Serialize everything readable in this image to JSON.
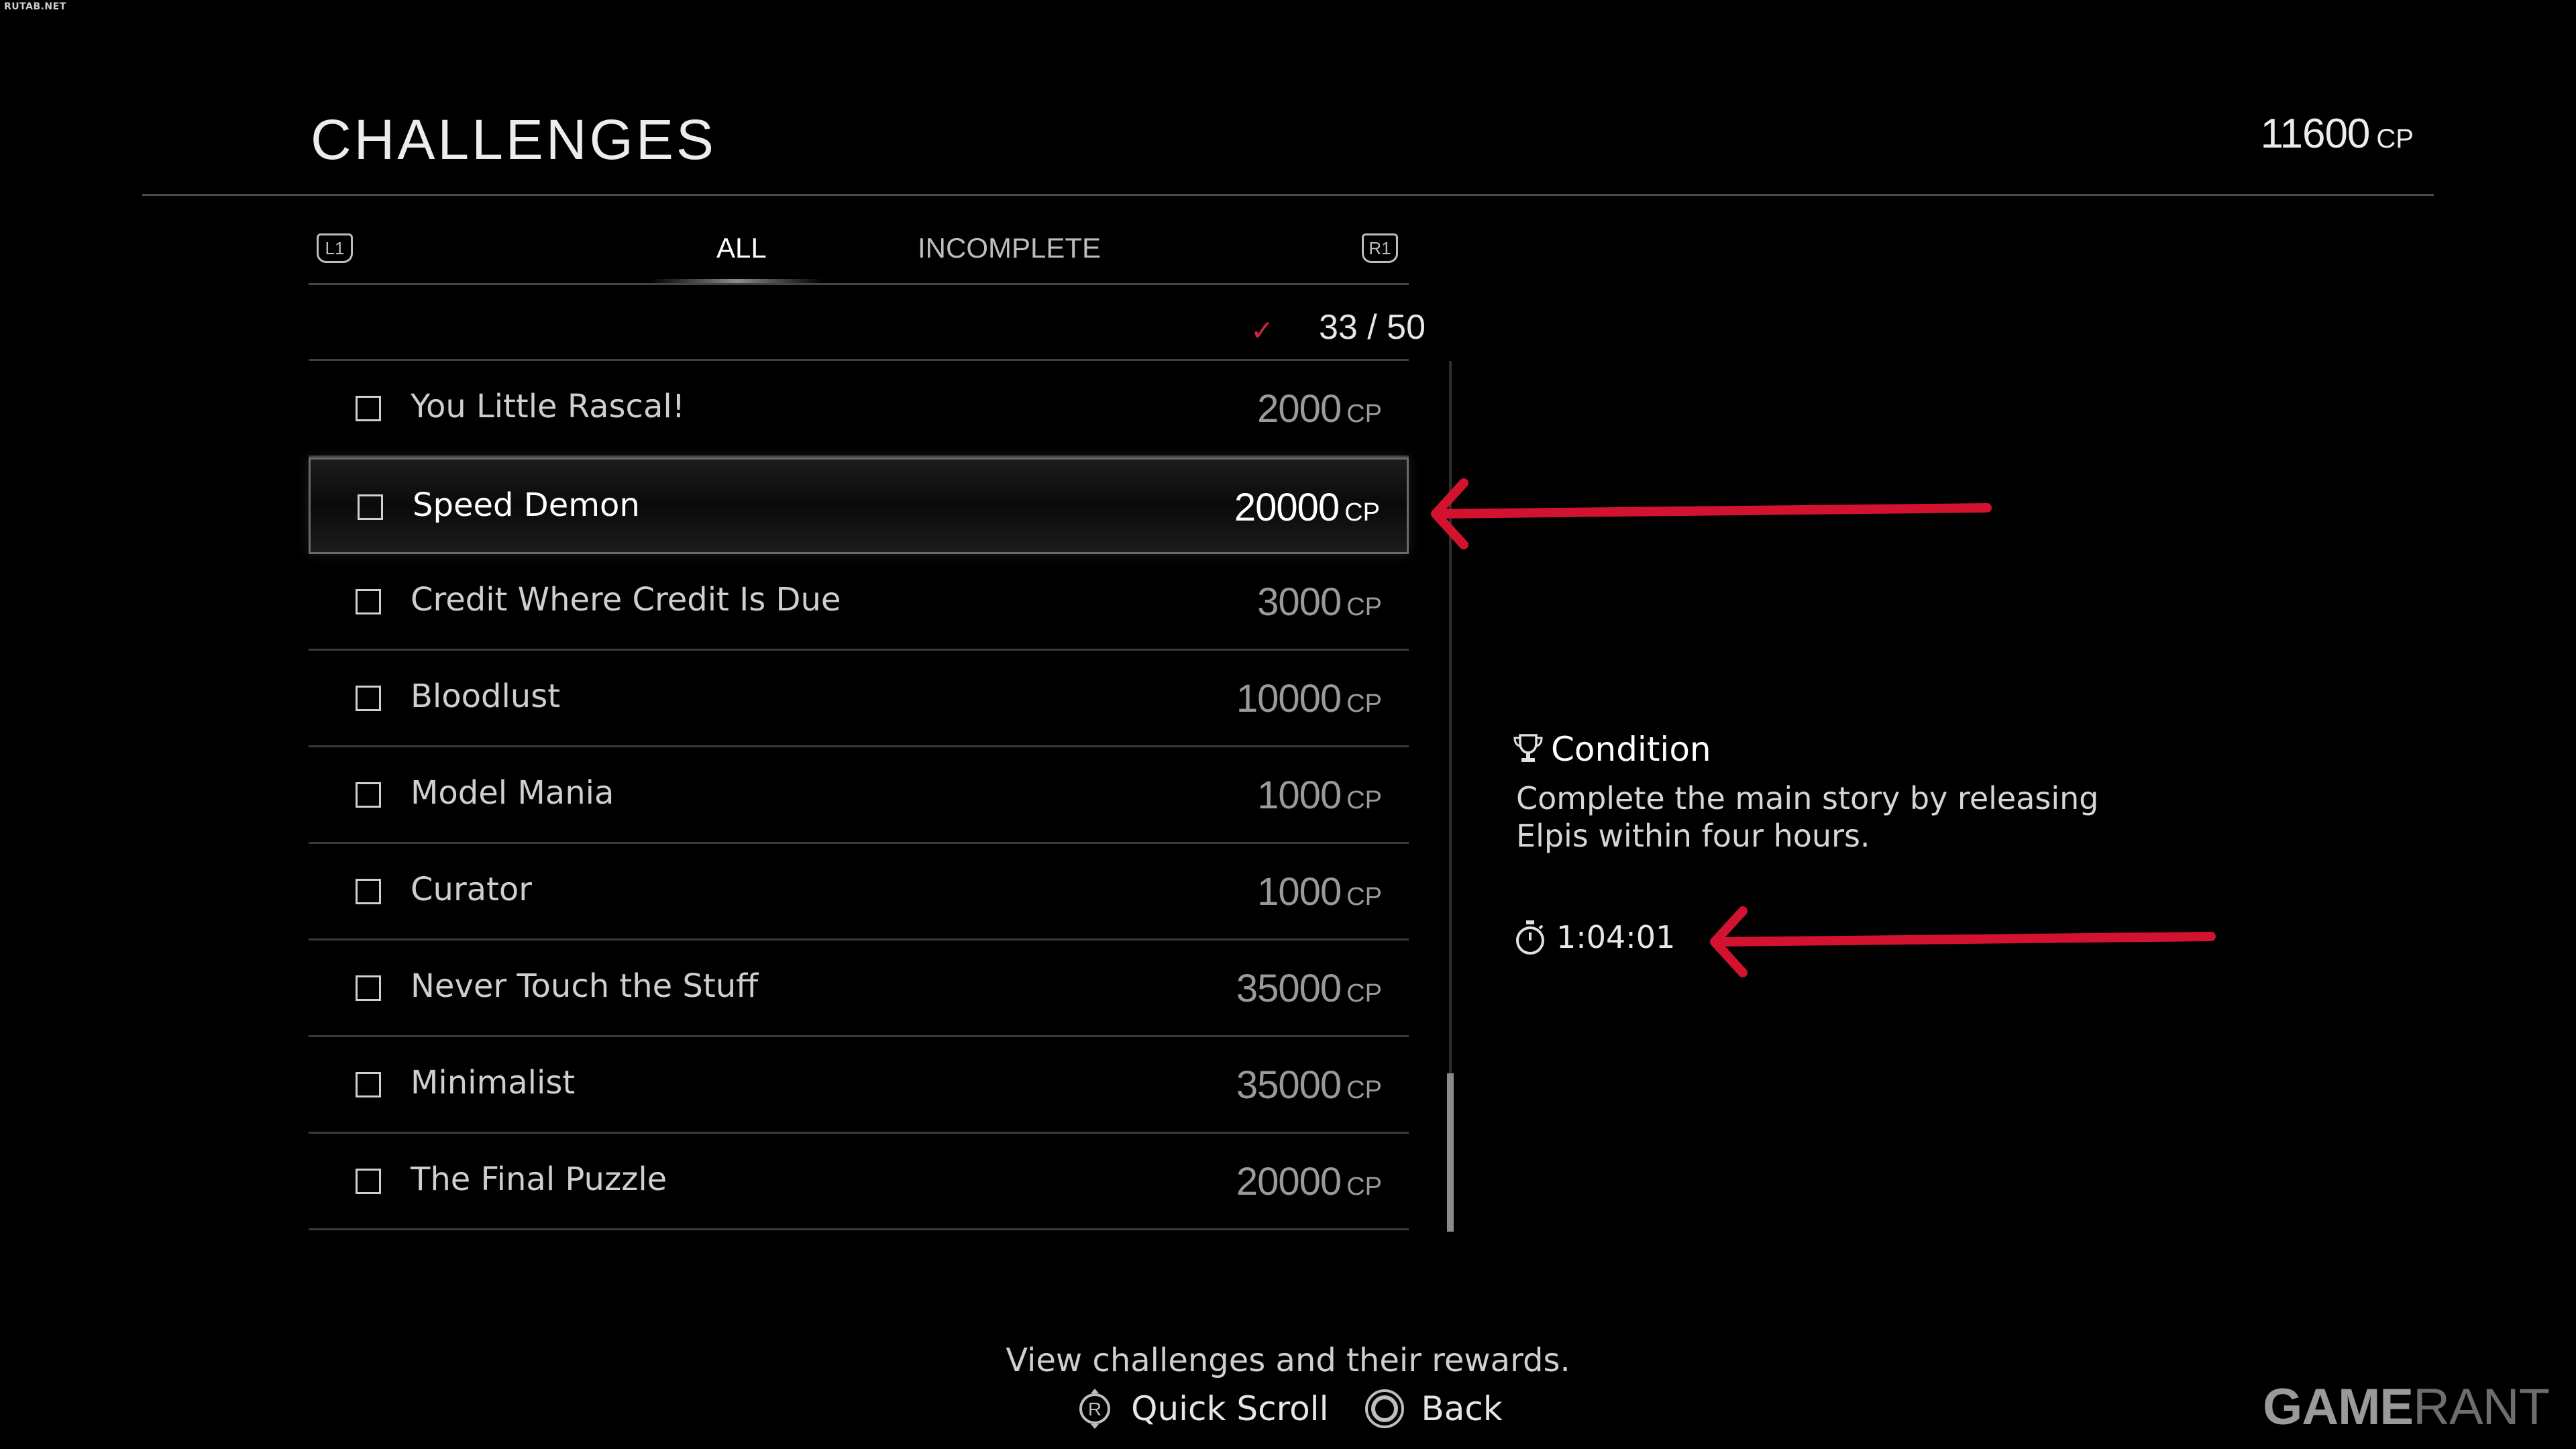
{
  "watermark": "RUTAB.NET",
  "header": {
    "title": "CHALLENGES",
    "cp_total": "11600",
    "cp_unit": "CP"
  },
  "tabs": {
    "left_button": "L1",
    "right_button": "R1",
    "items": [
      {
        "label": "ALL",
        "active": true
      },
      {
        "label": "INCOMPLETE",
        "active": false
      }
    ]
  },
  "progress": {
    "completed": 33,
    "total": 50,
    "text": "33 / 50",
    "check_color": "#c8283c"
  },
  "challenges": [
    {
      "name": "You Little Rascal!",
      "cp": "2000",
      "unit": "CP",
      "completed": false,
      "selected": false
    },
    {
      "name": "Speed Demon",
      "cp": "20000",
      "unit": "CP",
      "completed": false,
      "selected": true
    },
    {
      "name": "Credit Where Credit Is Due",
      "cp": "3000",
      "unit": "CP",
      "completed": false,
      "selected": false
    },
    {
      "name": "Bloodlust",
      "cp": "10000",
      "unit": "CP",
      "completed": false,
      "selected": false
    },
    {
      "name": "Model Mania",
      "cp": "1000",
      "unit": "CP",
      "completed": false,
      "selected": false
    },
    {
      "name": "Curator",
      "cp": "1000",
      "unit": "CP",
      "completed": false,
      "selected": false
    },
    {
      "name": "Never Touch the Stuff",
      "cp": "35000",
      "unit": "CP",
      "completed": false,
      "selected": false
    },
    {
      "name": "Minimalist",
      "cp": "35000",
      "unit": "CP",
      "completed": false,
      "selected": false
    },
    {
      "name": "The Final Puzzle",
      "cp": "20000",
      "unit": "CP",
      "completed": false,
      "selected": false
    }
  ],
  "detail": {
    "condition_label": "Condition",
    "condition_line1": "Complete the main story by releasing",
    "condition_line2": "Elpis within four hours.",
    "timer": "1:04:01",
    "icons": [
      "trophy-icon",
      "stopwatch-icon"
    ]
  },
  "annotation_color": "#d2122e",
  "footer": {
    "hint": "View challenges and their rewards.",
    "controls": [
      {
        "icon": "right-stick-icon",
        "glyph": "R",
        "label": "Quick Scroll"
      },
      {
        "icon": "circle-button-icon",
        "label": "Back"
      }
    ]
  },
  "brand": {
    "part1": "GAME",
    "part2": "RANT"
  }
}
